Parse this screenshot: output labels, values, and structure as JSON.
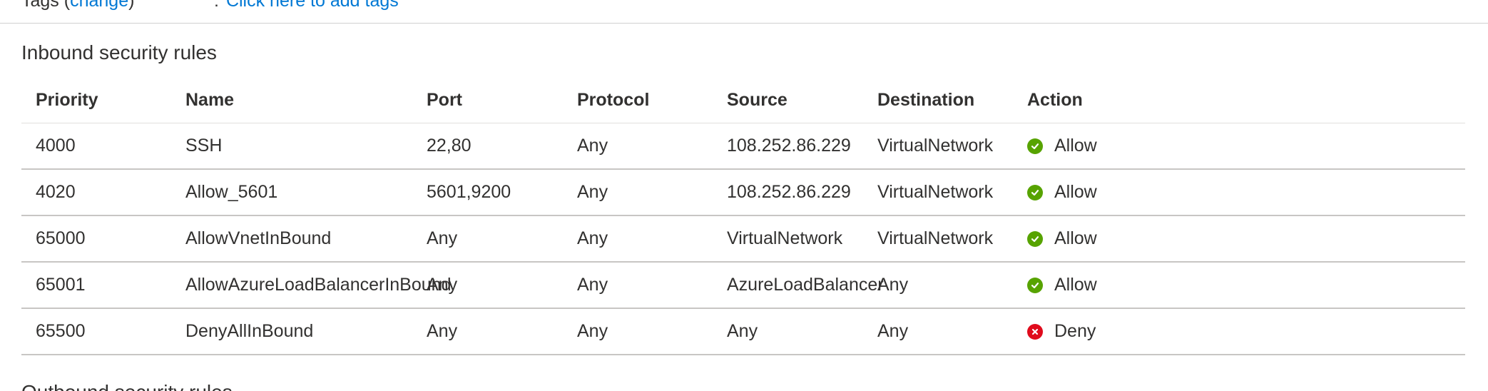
{
  "tags": {
    "label": "Tags (",
    "change_link": "change",
    "label_end": ")",
    "colon": ":",
    "add_tags_link": "Click here to add tags"
  },
  "inbound": {
    "title": "Inbound security rules",
    "columns": [
      "Priority",
      "Name",
      "Port",
      "Protocol",
      "Source",
      "Destination",
      "Action"
    ],
    "rows": [
      {
        "priority": "4000",
        "name": "SSH",
        "port": "22,80",
        "protocol": "Any",
        "source": "108.252.86.229",
        "destination": "VirtualNetwork",
        "action": "Allow",
        "action_icon": "check-circle-icon",
        "action_color": "#57a300"
      },
      {
        "priority": "4020",
        "name": "Allow_5601",
        "port": "5601,9200",
        "protocol": "Any",
        "source": "108.252.86.229",
        "destination": "VirtualNetwork",
        "action": "Allow",
        "action_icon": "check-circle-icon",
        "action_color": "#57a300"
      },
      {
        "priority": "65000",
        "name": "AllowVnetInBound",
        "port": "Any",
        "protocol": "Any",
        "source": "VirtualNetwork",
        "destination": "VirtualNetwork",
        "action": "Allow",
        "action_icon": "check-circle-icon",
        "action_color": "#57a300"
      },
      {
        "priority": "65001",
        "name": "AllowAzureLoadBalancerInBound",
        "port": "Any",
        "protocol": "Any",
        "source": "AzureLoadBalancer",
        "destination": "Any",
        "action": "Allow",
        "action_icon": "check-circle-icon",
        "action_color": "#57a300"
      },
      {
        "priority": "65500",
        "name": "DenyAllInBound",
        "port": "Any",
        "protocol": "Any",
        "source": "Any",
        "destination": "Any",
        "action": "Deny",
        "action_icon": "error-circle-icon",
        "action_color": "#e00b1c"
      }
    ]
  },
  "outbound": {
    "title": "Outbound security rules"
  },
  "colors": {
    "link": "#0078d4",
    "text": "#323130",
    "allow": "#57a300",
    "deny": "#e00b1c"
  }
}
